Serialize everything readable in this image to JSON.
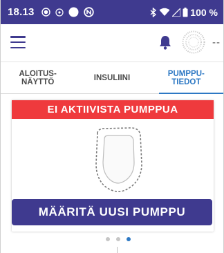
{
  "status_bar": {
    "time": "18.13",
    "battery_text": "100 %",
    "icons": [
      "record-icon",
      "cast-icon",
      "circle-icon",
      "nfc-icon",
      "bluetooth-icon",
      "wifi-icon",
      "signal-icon",
      "battery-icon"
    ]
  },
  "app_bar": {
    "glucose_placeholder": "--"
  },
  "tabs": [
    {
      "label": "ALOITUS-\nNÄYTTÖ",
      "active": false
    },
    {
      "label": "INSULIINI",
      "active": false
    },
    {
      "label": "PUMPPU-\nTIEDOT",
      "active": true
    }
  ],
  "card": {
    "banner": "EI AKTIIVISTA PUMPPUA",
    "button_label": "MÄÄRITÄ UUSI PUMPPU"
  },
  "pager": {
    "count": 3,
    "active_index": 2
  },
  "colors": {
    "primary": "#3f3a8f",
    "alert": "#ef3a3d",
    "accent": "#2d78c4"
  }
}
